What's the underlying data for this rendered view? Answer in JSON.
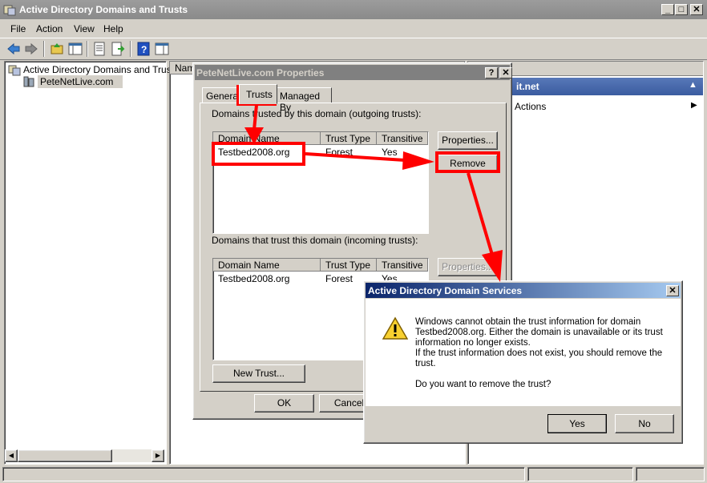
{
  "window": {
    "title": "Active Directory Domains and Trusts"
  },
  "menu": [
    "File",
    "Action",
    "View",
    "Help"
  ],
  "tree": {
    "root": "Active Directory Domains and Trusts",
    "child": "PeteNetLive.com"
  },
  "list": {
    "header_fragment": "Nam"
  },
  "actions": {
    "header_fragment": "it.net",
    "item": "Actions"
  },
  "props": {
    "title": "PeteNetLive.com Properties",
    "tabs": [
      "General",
      "Trusts",
      "Managed By"
    ],
    "outgoing_label": "Domains trusted by this domain (outgoing trusts):",
    "incoming_label": "Domains that trust this domain (incoming trusts):",
    "columns": [
      "Domain Name",
      "Trust Type",
      "Transitive"
    ],
    "outgoing_rows": [
      {
        "name": "Testbed2008.org",
        "type": "Forest",
        "transitive": "Yes"
      }
    ],
    "incoming_rows": [
      {
        "name": "Testbed2008.org",
        "type": "Forest",
        "transitive": "Yes"
      }
    ],
    "properties_btn": "Properties...",
    "remove_btn": "Remove",
    "properties_btn2": "Properties...",
    "new_trust_btn": "New Trust...",
    "ok_btn": "OK",
    "cancel_btn": "Cancel"
  },
  "dialog": {
    "title": "Active Directory Domain Services",
    "line1": "Windows cannot obtain the trust information for domain",
    "line2": "Testbed2008.org. Either the domain is unavailable or its trust",
    "line3": "information no longer exists.",
    "line4": "If the trust information does not exist, you should remove the",
    "line5": "trust.",
    "question": "Do you want to remove the trust?",
    "yes_btn": "Yes",
    "no_btn": "No"
  },
  "colors": {
    "annotation": "#ff0000",
    "dialog_title": "#0a246a",
    "inactive_title": "#808080"
  }
}
